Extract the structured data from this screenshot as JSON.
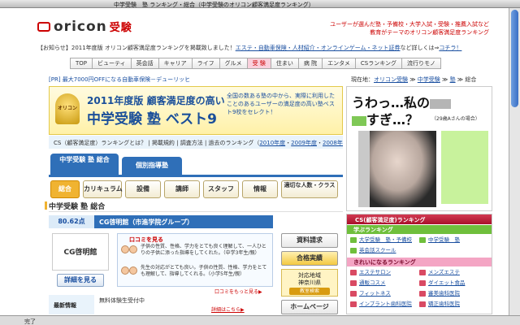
{
  "window": {
    "title": "中学受験　塾 ランキング・総合（中学受験のオリコン顧客満足度ランキング）",
    "status": "完了"
  },
  "header": {
    "logo_main": "oricon",
    "logo_sub": "受験",
    "tagline": "ユーザーが選んだ塾・予備校・大学入試・受験・推薦入試など 教育がテーマのオリコン顧客満足度ランキング",
    "notice_prefix": "【お知らせ】2011年度版 オリコン顧客満足度ランキングを掲載致しました！",
    "notice_links": "エステ・自動車保険・人材紹介・オンラインゲーム・ネット証券",
    "notice_suffix": "など詳しくは⇒",
    "notice_here": "コチラ！"
  },
  "nav": [
    "TOP",
    "ビューティ",
    "英会話",
    "キャリア",
    "ライフ",
    "グルメ",
    "受 験",
    "住まい",
    "病 院",
    "エンタメ",
    "CSランキング",
    "流行りモノ"
  ],
  "pr": "[PR] 最大7000円OFFになる自動車保険－デューリッヒ",
  "breadcrumb": {
    "prefix": "現在地：",
    "links": [
      "オリコン受験",
      "中学受験",
      "塾"
    ],
    "current": "総合"
  },
  "banner": {
    "medal": "オリコン",
    "line1": "2011年度版 顧客満足度の高い",
    "line2": "中学受験 塾 ベスト9",
    "desc": "全国の数ある塾の中から、実際に利用したことのあるユーザーの満足度の高い塾ベスト9校をセレクト！"
  },
  "links": {
    "row1": "CS（顧客満足度）ランキングとは？ | 掲載規約 | 調査方法 | 過去のランキング（",
    "years": [
      "2010年度",
      "2009年度",
      "2008年度"
    ],
    "row1_end": "）"
  },
  "tabs": [
    "中学受験 塾 総合",
    "個別指導塾"
  ],
  "subtabs": [
    "総合",
    "カリキュラム",
    "設備",
    "講師",
    "スタッフ",
    "情報",
    "適切な人数・クラス"
  ],
  "section_title": "中学受験 塾 総合",
  "school": {
    "score": "80.62点",
    "name": "CG啓明館（市進学院グループ）",
    "logo_text": "CG啓明館",
    "detail": "詳細を見る"
  },
  "reviews": {
    "title": "口コミを見る",
    "r1": "子供の性質、性格、学力をとても良く理解して、一人ひとりの子供に添った指導をしてくれた。（中学3年生/親）",
    "r2": "先生の対応がとても良い。子供の性質、性格、学力をとても理解して、指導してくれる。（小学5年生/親）",
    "more": "口コミをもっと見る▶"
  },
  "side": {
    "btn1": "資料請求",
    "btn2": "合格実績",
    "area_label": "対応地域",
    "area": "神奈川県",
    "area_btn": "教室検索",
    "btn3": "ホームページ"
  },
  "news": {
    "label": "最新情報",
    "text": "無料体験生受付中",
    "more": "詳細はこちら▶"
  },
  "ad": {
    "h1a": "うわっ…私の",
    "h2b": "すぎ…？",
    "note": "（29歳Aさんの場合）"
  },
  "ranking": {
    "head": "CS(顧客満足度)ランキング",
    "sub1": "学ぶランキング",
    "learn": [
      "大学受験　塾・予備校",
      "中学受験　塾",
      "英会話スクール"
    ],
    "sub2": "きれいになるランキング",
    "beauty": [
      "エステサロン",
      "メンズエステ",
      "通販コスメ",
      "ダイエット食品",
      "フィットネス",
      "審美歯科医院",
      "インプラント歯科医院",
      "矯正歯科医院"
    ]
  },
  "colors": {
    "brand_red": "#cc0000",
    "link_blue": "#1a4fa0",
    "tab_blue": "#2f6fb8",
    "accent_gold": "#f0b331"
  }
}
